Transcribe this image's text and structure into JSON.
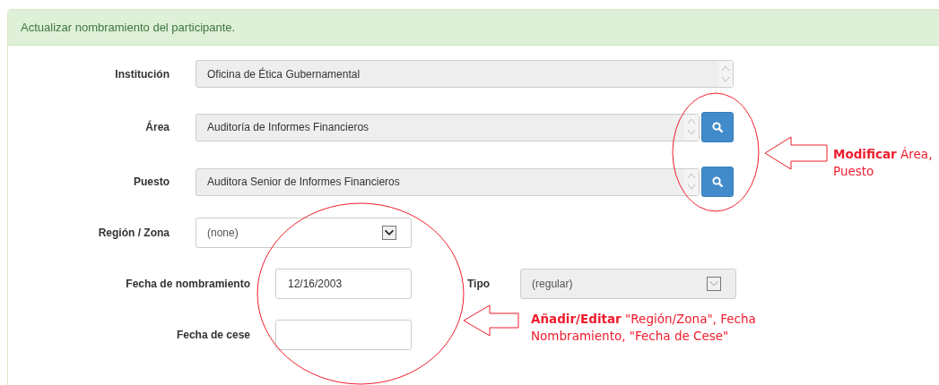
{
  "panel": {
    "title": "Actualizar nombramiento del participante."
  },
  "rows": [
    {
      "label": "Institución",
      "field": {
        "kind": "spinner",
        "value": "Oficina de Ética Gubernamental",
        "disabled": true,
        "search_button": false
      }
    },
    {
      "label": "Área",
      "field": {
        "kind": "spinner",
        "value": "Auditoría de Informes Financieros",
        "disabled": true,
        "search_button": true
      }
    },
    {
      "label": "Puesto",
      "field": {
        "kind": "spinner",
        "value": "Auditora Senior de Informes Financieros",
        "disabled": true,
        "search_button": true
      }
    },
    {
      "label": "Región / Zona",
      "field": {
        "kind": "select",
        "value": "(none)",
        "disabled": false
      }
    },
    {
      "label": "Fecha de nombramiento",
      "field": {
        "kind": "date",
        "value": "12/16/2003",
        "disabled": false
      },
      "side": {
        "label": "Tipo",
        "field": {
          "kind": "select",
          "value": "(regular)",
          "disabled": true
        }
      }
    },
    {
      "label": "Fecha de cese",
      "field": {
        "kind": "date",
        "disabled": false
      }
    }
  ],
  "annotations": [
    {
      "lines": [
        "**Modificar** Área,",
        "Puesto"
      ]
    },
    {
      "lines": [
        "**Añadir/Editar** \"Región/Zona\", Fecha",
        "Nombramiento, \"Fecha de Cese\""
      ]
    }
  ]
}
